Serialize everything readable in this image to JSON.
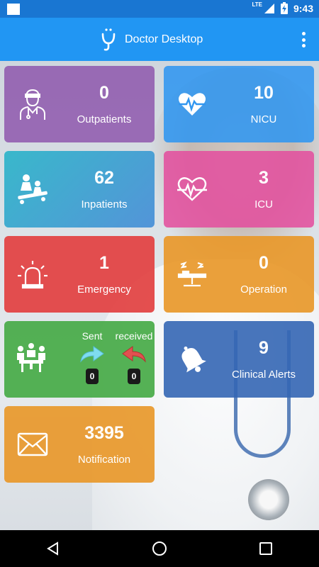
{
  "status_bar": {
    "network": "LTE",
    "time": "9:43"
  },
  "app_bar": {
    "title": "Doctor Desktop"
  },
  "tiles": {
    "outpatients": {
      "count": "0",
      "label": "Outpatients"
    },
    "nicu": {
      "count": "10",
      "label": "NICU"
    },
    "inpatients": {
      "count": "62",
      "label": "Inpatients"
    },
    "icu": {
      "count": "3",
      "label": "ICU"
    },
    "emergency": {
      "count": "1",
      "label": "Emergency"
    },
    "operation": {
      "count": "0",
      "label": "Operation"
    },
    "referrals": {
      "sent_label": "Sent",
      "received_label": "received",
      "sent_count": "0",
      "received_count": "0"
    },
    "clinical_alerts": {
      "count": "9",
      "label": "Clinical Alerts"
    },
    "notification": {
      "count": "3395",
      "label": "Notification"
    }
  },
  "colors": {
    "app_bar": "#2196f3",
    "status_bar": "#1976d2",
    "outpatients": "#8e57ad",
    "nicu": "#3096f0",
    "inpatients": "#28b4c8",
    "icu": "#e2509e",
    "emergency": "#e24040",
    "operation": "#e8982a",
    "referrals": "#46aa46",
    "clinical_alerts": "#3466b4",
    "notification": "#e8982a"
  },
  "icons": {
    "outpatients": "doctor-icon",
    "nicu": "heartbeat-icon",
    "inpatients": "stretcher-icon",
    "icu": "heart-pulse-icon",
    "emergency": "alarm-light-icon",
    "operation": "operating-table-icon",
    "referrals": "meeting-icon",
    "referral_sent": "arrow-right-icon",
    "referral_received": "arrow-left-icon",
    "clinical_alerts": "bell-icon",
    "notification": "envelope-icon"
  }
}
